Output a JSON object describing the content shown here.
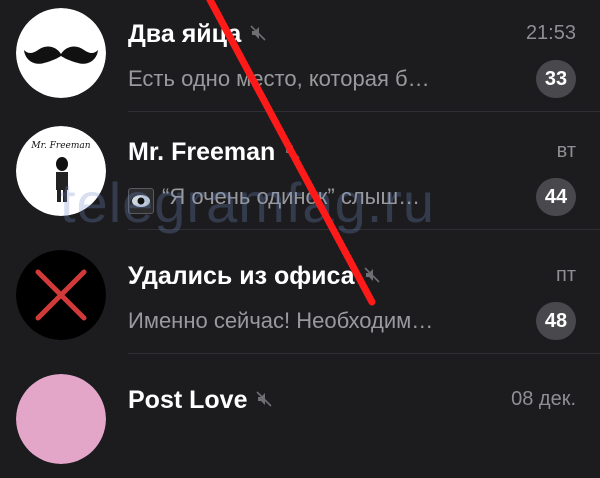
{
  "chats": [
    {
      "title": "Два яйца",
      "time": "21:53",
      "preview": "Есть одно место, которая б…",
      "unread": "33",
      "muted": true,
      "avatar_icon": "mustache-icon"
    },
    {
      "title": "Mr. Freeman",
      "time": "вт",
      "preview": "“Я очень одинок” слыш…",
      "unread": "44",
      "muted": true,
      "avatar_icon": "mr-freeman-avatar",
      "avatar_caption": "Mr. Freeman"
    },
    {
      "title": "Удались из офиса",
      "time": "пт",
      "preview": "Именно сейчас! Необходим…",
      "unread": "48",
      "muted": true,
      "avatar_icon": "red-cross-icon"
    },
    {
      "title": "Post Love",
      "time": "08 дек.",
      "preview": "",
      "unread": "",
      "muted": true,
      "avatar_icon": "pink-avatar"
    }
  ],
  "watermark": "telegramfag.ru",
  "colors": {
    "background": "#1c1c1e",
    "badge": "#49494d",
    "annotation_stroke": "#ff1a1a"
  }
}
